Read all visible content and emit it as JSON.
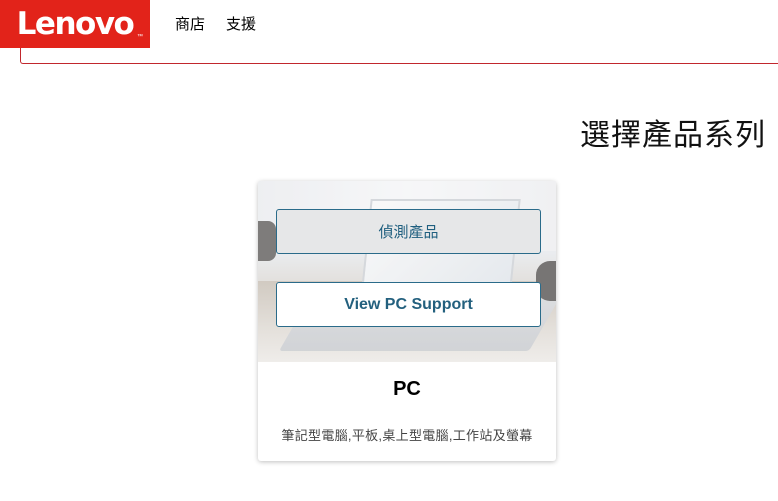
{
  "header": {
    "logo_text": "Lenovo",
    "logo_tm": "™",
    "nav": [
      {
        "label": "商店"
      },
      {
        "label": "支援"
      }
    ]
  },
  "main": {
    "title": "選擇產品系列"
  },
  "card": {
    "detect_button": "偵測產品",
    "view_button": "View PC Support",
    "title": "PC",
    "description": "筆記型電腦,平板,桌上型電腦,工作站及螢幕"
  },
  "colors": {
    "brand_red": "#e2231a",
    "button_border": "#2a6b8a",
    "button_text": "#1f5f7f"
  }
}
